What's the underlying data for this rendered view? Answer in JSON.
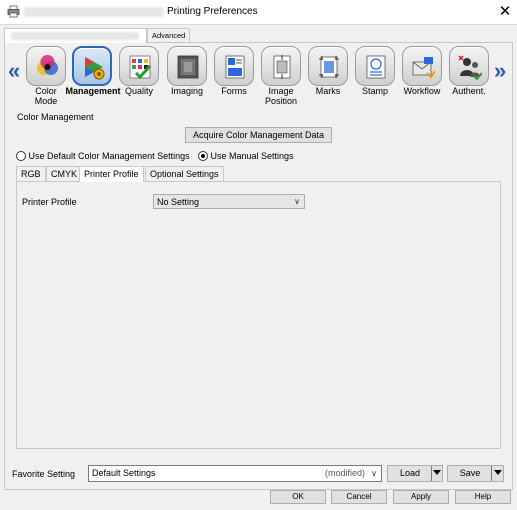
{
  "window": {
    "title": "Printing Preferences",
    "close_symbol": "✕"
  },
  "top_tabs": [
    {
      "label": "",
      "active": true
    },
    {
      "label": "Advanced",
      "active": false
    }
  ],
  "nav": {
    "left_arrow": "«",
    "right_arrow": "»",
    "items": [
      {
        "label": "Color\nMode",
        "icon": "color-mode-icon",
        "selected": false
      },
      {
        "label": "Management",
        "icon": "color-management-icon",
        "selected": true
      },
      {
        "label": "Quality",
        "icon": "quality-icon",
        "selected": false
      },
      {
        "label": "Imaging",
        "icon": "imaging-icon",
        "selected": false
      },
      {
        "label": "Forms",
        "icon": "forms-icon",
        "selected": false
      },
      {
        "label": "Image\nPosition",
        "icon": "image-position-icon",
        "selected": false
      },
      {
        "label": "Marks",
        "icon": "marks-icon",
        "selected": false
      },
      {
        "label": "Stamp",
        "icon": "stamp-icon",
        "selected": false
      },
      {
        "label": "Workflow",
        "icon": "workflow-icon",
        "selected": false
      },
      {
        "label": "Authent.",
        "icon": "authentication-icon",
        "selected": false
      }
    ]
  },
  "color_management": {
    "group_title": "Color Management",
    "acquire_button": "Acquire Color Management Data",
    "radio_default": "Use Default Color Management Settings",
    "radio_manual": "Use Manual Settings",
    "selected_radio": "manual",
    "subtabs": [
      {
        "label": "RGB",
        "active": false
      },
      {
        "label": "CMYK",
        "active": false
      },
      {
        "label": "Printer Profile",
        "active": true
      },
      {
        "label": "Optional Settings",
        "active": false
      }
    ],
    "printer_profile_label": "Printer Profile",
    "printer_profile_value": "No Setting"
  },
  "favorite": {
    "label": "Favorite Setting",
    "value": "Default Settings",
    "modified": "(modified)",
    "load_button": "Load",
    "save_button": "Save"
  },
  "buttons": {
    "ok": "OK",
    "cancel": "Cancel",
    "apply": "Apply",
    "help": "Help"
  },
  "colors": {
    "accent": "#2f67b8",
    "dialog_bg": "#f0f0f0"
  }
}
